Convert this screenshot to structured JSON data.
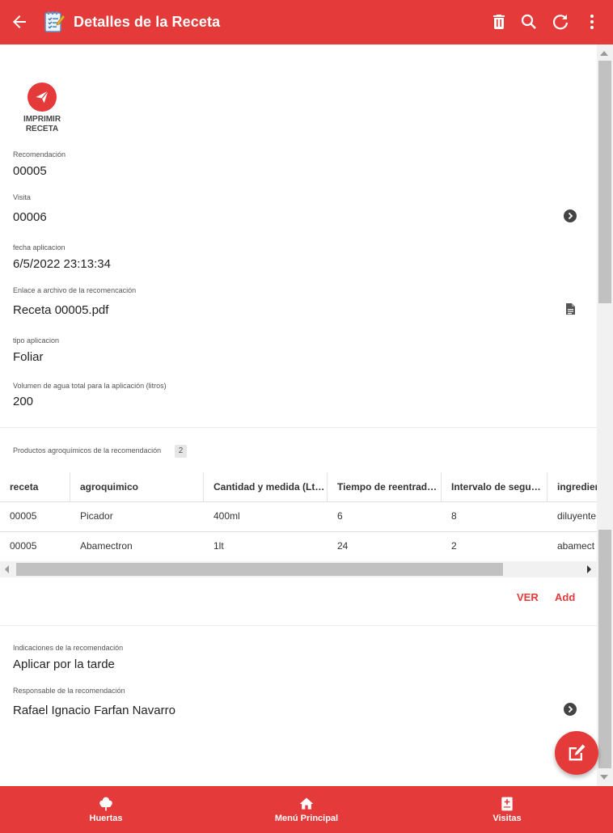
{
  "app_bar": {
    "title": "Detalles de la Receta",
    "actions": [
      "delete-icon",
      "search-icon",
      "refresh-icon",
      "more-vert-icon"
    ],
    "color": "#e43a3a"
  },
  "print_action": {
    "label": "IMPRIMIR RECETA"
  },
  "fields": {
    "recomendacion": {
      "label": "Recomendación",
      "value": "00005"
    },
    "visita": {
      "label": "Visita",
      "value": "00006"
    },
    "fecha": {
      "label": "fecha aplicacion",
      "value": "6/5/2022 23:13:34"
    },
    "enlace": {
      "label": "Enlace a archivo de la recomencación",
      "value": "Receta 00005.pdf"
    },
    "tipo": {
      "label": "tipo aplicacion",
      "value": "Foliar"
    },
    "volumen": {
      "label": "Volumen de agua total para la aplicación (litros)",
      "value": "200"
    }
  },
  "products": {
    "label": "Productos agroquímicos de la recomendación",
    "count": "2",
    "columns": [
      "receta",
      "agroquimico",
      "Cantidad y medida (Lts,...",
      "Tiempo de reentrada ...",
      "Intervalo de seguri...",
      "ingredien"
    ],
    "rows": [
      [
        "00005",
        "Picador",
        "400ml",
        "6",
        "8",
        "diluyente"
      ],
      [
        "00005",
        "Abamectron",
        "1lt",
        "24",
        "2",
        "abamect"
      ]
    ],
    "ver_label": "VER",
    "add_label": "Add"
  },
  "indicaciones": {
    "label": "Indicaciones de la recomendación",
    "value": "Aplicar por la tarde"
  },
  "responsable": {
    "label": "Responsable de la recomendación",
    "value": "Rafael Ignacio Farfan Navarro"
  },
  "bottom_nav": [
    {
      "label": "Huertas",
      "icon": "tree-icon"
    },
    {
      "label": "Menú Principal",
      "icon": "home-icon"
    },
    {
      "label": "Visitas",
      "icon": "medical-book-icon"
    }
  ]
}
